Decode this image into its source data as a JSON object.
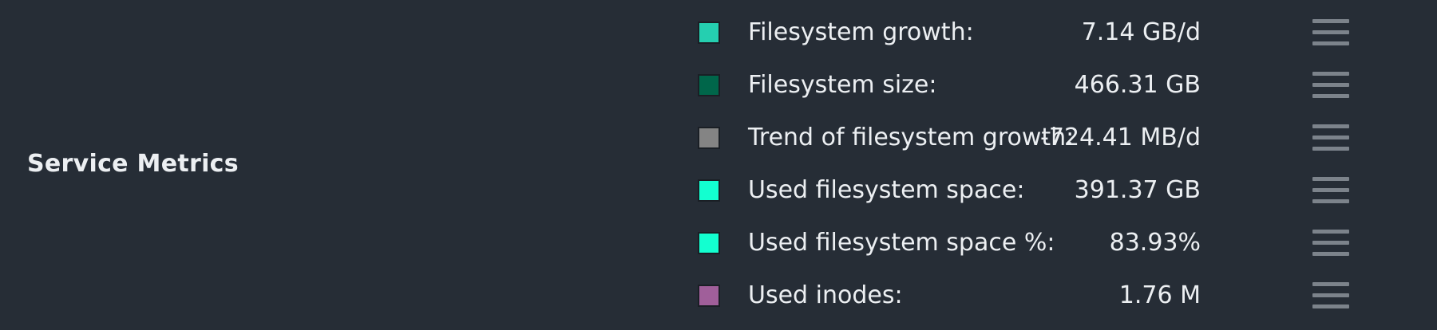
{
  "section": {
    "title": "Service Metrics"
  },
  "metrics": [
    {
      "name": "Filesystem growth:",
      "value": "7.14 GB/d",
      "color": "#25cfb0",
      "icon": "hamburger-menu-icon"
    },
    {
      "name": "Filesystem size:",
      "value": "466.31 GB",
      "color": "#00664a",
      "icon": "hamburger-menu-icon"
    },
    {
      "name": "Trend of filesystem growth:",
      "value": "-724.41 MB/d",
      "color": "#848484",
      "icon": "hamburger-menu-icon"
    },
    {
      "name": "Used filesystem space:",
      "value": "391.37 GB",
      "color": "#13ffd0",
      "icon": "hamburger-menu-icon"
    },
    {
      "name": "Used filesystem space %:",
      "value": "83.93%",
      "color": "#13ffd0",
      "icon": "hamburger-menu-icon"
    },
    {
      "name": "Used inodes:",
      "value": "1.76 M",
      "color": "#a05f9a",
      "icon": "hamburger-menu-icon"
    }
  ]
}
